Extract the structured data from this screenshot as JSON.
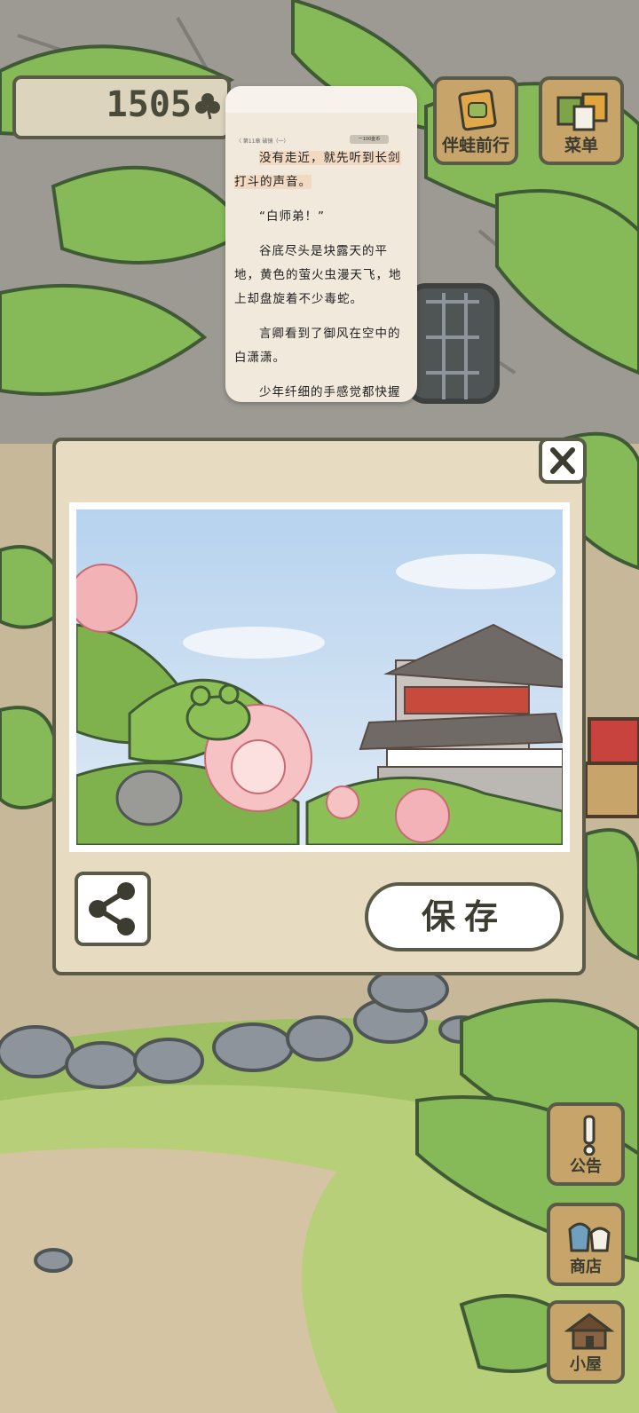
{
  "game": {
    "clover_count": "1505",
    "top_buttons": [
      {
        "label": "伴蛙前行",
        "icon": "frog-card-icon"
      },
      {
        "label": "菜单",
        "icon": "menu-cards-icon"
      }
    ],
    "side_buttons": [
      {
        "label": "公告",
        "icon": "exclamation-icon"
      },
      {
        "label": "商店",
        "icon": "shop-bags-icon"
      },
      {
        "label": "小屋",
        "icon": "house-icon"
      }
    ]
  },
  "reader_overlay": {
    "chapter_title": "〈 第11章 破镜（一）",
    "chip_text": "一100金币",
    "paragraphs": [
      "没有走近，就先听到长剑打斗的声音。",
      "“白师弟！”",
      "谷底尽头是块露天的平地，黄色的萤火虫漫天飞，地上却盘旋着不少毒蛇。",
      "言卿看到了御风在空中的白潇潇。",
      "少年纤细的手感觉都快握"
    ]
  },
  "photo_dialog": {
    "save_label": "保存",
    "share_icon": "share-icon",
    "close_icon": "close-icon"
  },
  "colors": {
    "outline": "#5a5a48",
    "wood": "#c7a46a",
    "panel": "#e7dcc1",
    "sky": "#c9dcef",
    "leaf": "#7fb24d"
  }
}
